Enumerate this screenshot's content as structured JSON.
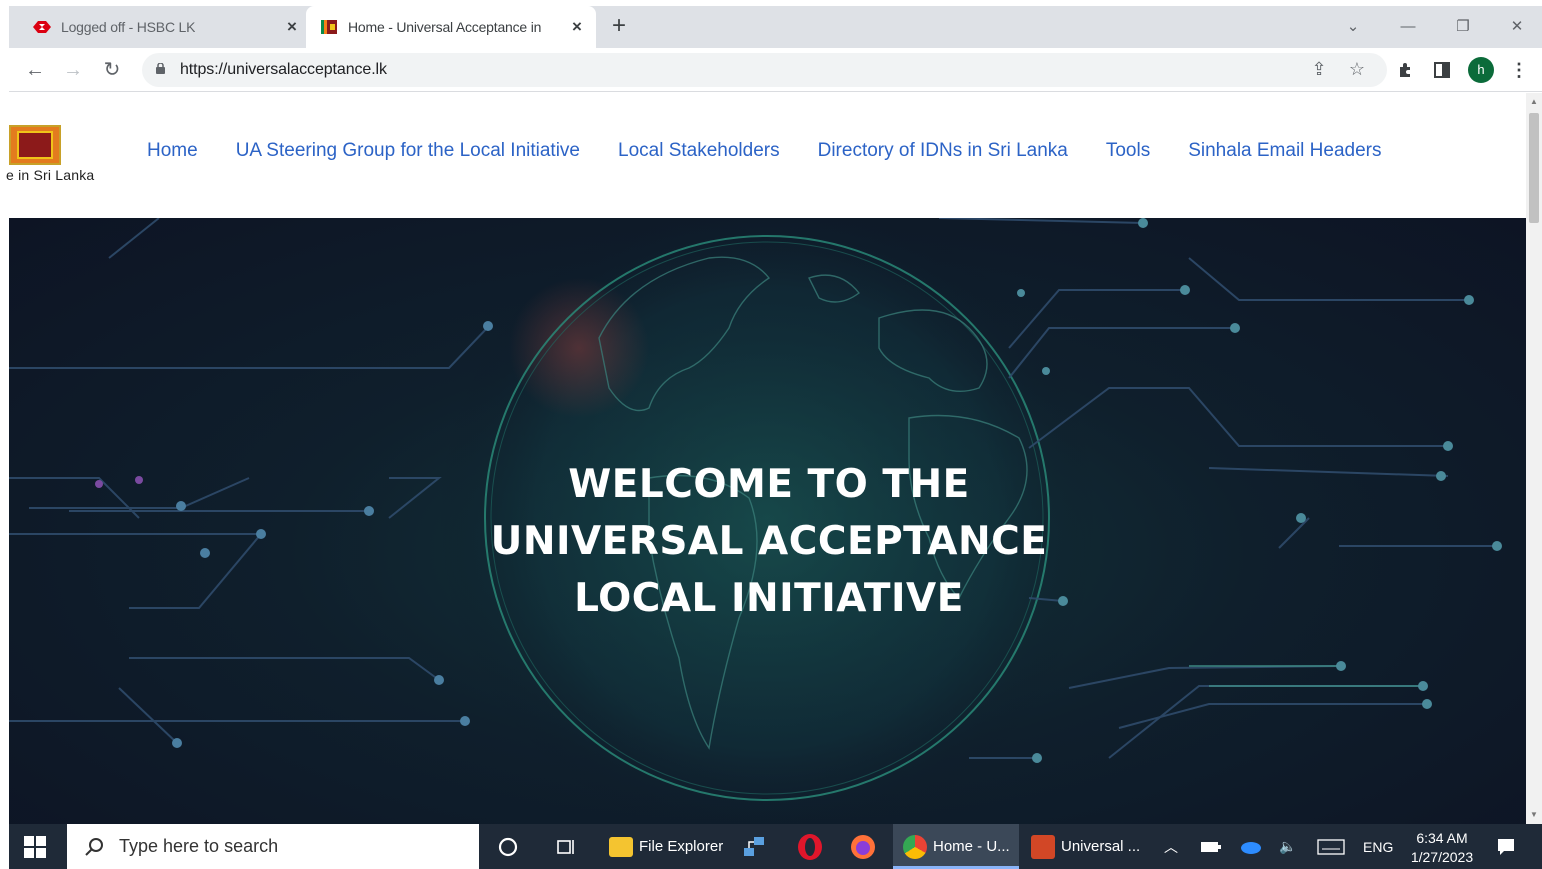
{
  "browser": {
    "tabs": [
      {
        "title": "Logged off - HSBC LK",
        "active": false,
        "favicon": "hsbc-icon"
      },
      {
        "title": "Home - Universal Acceptance in",
        "active": true,
        "favicon": "site-flag-icon"
      }
    ],
    "url": "https://universalacceptance.lk",
    "profile_initial": "h"
  },
  "site": {
    "logo_caption": "e in Sri Lanka",
    "menu": [
      "Home",
      "UA Steering Group for the Local Initiative",
      "Local Stakeholders",
      "Directory of IDNs in Sri Lanka",
      "Tools",
      "Sinhala Email Headers"
    ],
    "hero_lines": [
      "WELCOME TO THE",
      "UNIVERSAL ACCEPTANCE",
      "LOCAL INITIATIVE"
    ],
    "link_color": "#2c63c6"
  },
  "taskbar": {
    "search_placeholder": "Type here to search",
    "apps": [
      {
        "label": "File Explorer",
        "icon": "folder-icon"
      },
      {
        "label": "Home - U...",
        "icon": "chrome-icon",
        "active": true
      },
      {
        "label": "Universal ...",
        "icon": "powerpoint-icon"
      }
    ],
    "language": "ENG",
    "time": "6:34 AM",
    "date": "1/27/2023"
  }
}
